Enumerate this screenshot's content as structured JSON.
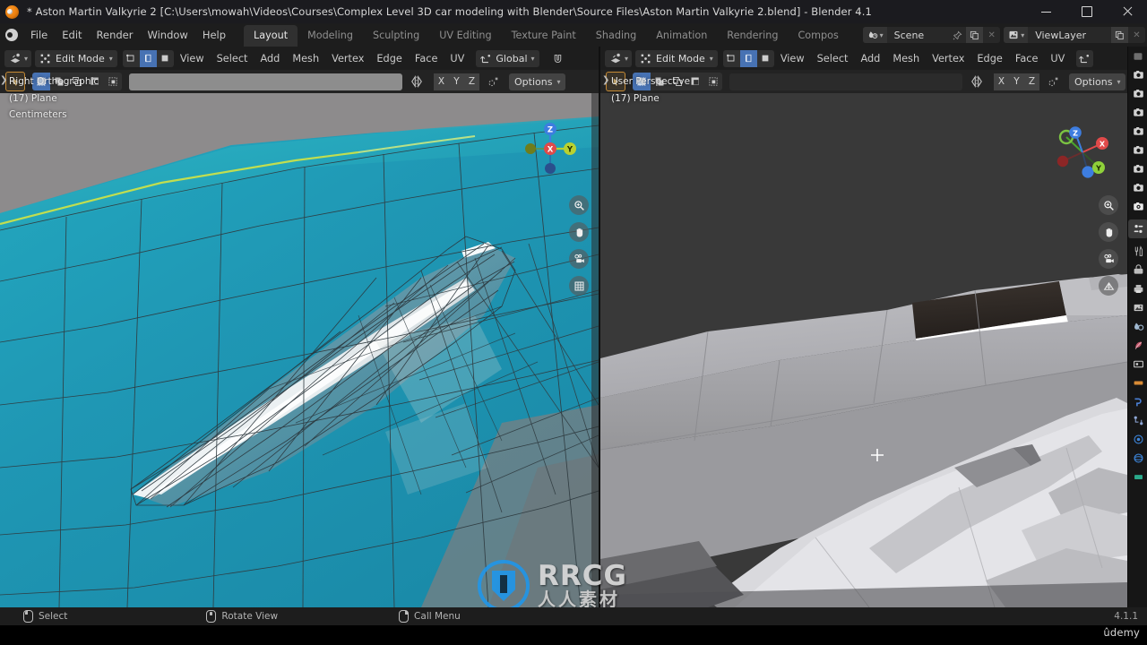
{
  "window": {
    "title": "* Aston Martin Valkyrie 2 [C:\\Users\\mowah\\Videos\\Courses\\Complex Level 3D car modeling with Blender\\Source Files\\Aston Martin Valkyrie 2.blend] - Blender 4.1",
    "app_icon": "blender-logo-icon",
    "controls": {
      "minimize": "minimize-icon",
      "maximize": "maximize-icon",
      "close": "close-icon"
    }
  },
  "topbar": {
    "app_menu_icon": "blender-menu-icon",
    "menus": [
      "File",
      "Edit",
      "Render",
      "Window",
      "Help"
    ],
    "workspace_tabs": [
      {
        "label": "Layout",
        "active": true
      },
      {
        "label": "Modeling",
        "active": false
      },
      {
        "label": "Sculpting",
        "active": false
      },
      {
        "label": "UV Editing",
        "active": false
      },
      {
        "label": "Texture Paint",
        "active": false
      },
      {
        "label": "Shading",
        "active": false
      },
      {
        "label": "Animation",
        "active": false
      },
      {
        "label": "Rendering",
        "active": false
      },
      {
        "label": "Compos",
        "active": false
      }
    ],
    "scene": {
      "icon": "scene-icon",
      "value": "Scene",
      "pin_icon": "pin-icon",
      "new_icon": "duplicate-icon",
      "unlink_icon": "x-icon"
    },
    "view_layer": {
      "icon": "view-layer-icon",
      "value": "ViewLayer",
      "new_icon": "duplicate-icon",
      "unlink_icon": "x-icon"
    }
  },
  "viewport_left": {
    "editor_type_icon": "editor-type-3dview-icon",
    "mode": "Edit Mode",
    "select_modes": [
      {
        "name": "vertex-select-icon",
        "active": false
      },
      {
        "name": "edge-select-icon",
        "active": true
      },
      {
        "name": "face-select-icon",
        "active": false
      }
    ],
    "menus": [
      "View",
      "Select",
      "Add",
      "Mesh",
      "Vertex",
      "Edge",
      "Face",
      "UV"
    ],
    "transform_orientation": {
      "icon": "orientation-icon",
      "value": "Global"
    },
    "tool_icon": "tweak-tool-icon",
    "snap_modes": [
      {
        "name": "set-mode-icon",
        "active": true
      },
      {
        "name": "extend-mode-icon",
        "active": false
      },
      {
        "name": "subtract-mode-icon",
        "active": false
      },
      {
        "name": "invert-mode-icon",
        "active": false
      },
      {
        "name": "intersect-mode-icon",
        "active": false
      }
    ],
    "mirror_icon": "mirror-icon",
    "axes": [
      "X",
      "Y",
      "Z"
    ],
    "proportional_icon": "proportional-editing-icon",
    "options_label": "Options",
    "overlay_lines": [
      "Right Orthographic",
      "(17) Plane",
      "Centimeters"
    ],
    "nav_gizmo": {
      "axis_labels": [
        "X",
        "Y",
        "Z"
      ],
      "colors": {
        "x": "#e04a4a",
        "y": "#b8d130",
        "z": "#3d7de0"
      }
    },
    "nav_buttons": [
      "zoom-icon",
      "pan-hand-icon",
      "camera-view-icon",
      "toggle-ortho-grid-icon"
    ]
  },
  "viewport_right": {
    "editor_type_icon": "editor-type-3dview-icon",
    "mode": "Edit Mode",
    "select_modes": [
      {
        "name": "vertex-select-icon",
        "active": false
      },
      {
        "name": "edge-select-icon",
        "active": true
      },
      {
        "name": "face-select-icon",
        "active": false
      }
    ],
    "menus": [
      "View",
      "Select",
      "Add",
      "Mesh",
      "Vertex",
      "Edge",
      "Face",
      "UV"
    ],
    "transform_orientation": {
      "icon": "orientation-icon",
      "value": ""
    },
    "tool_icon": "tweak-tool-icon",
    "snap_modes": [
      {
        "name": "set-mode-icon",
        "active": true
      },
      {
        "name": "extend-mode-icon",
        "active": false
      },
      {
        "name": "subtract-mode-icon",
        "active": false
      },
      {
        "name": "invert-mode-icon",
        "active": false
      },
      {
        "name": "intersect-mode-icon",
        "active": false
      }
    ],
    "mirror_icon": "mirror-icon",
    "axes": [
      "X",
      "Y",
      "Z"
    ],
    "proportional_icon": "proportional-editing-icon",
    "options_label": "Options",
    "overlay_lines": [
      "User Perspective",
      "(17) Plane"
    ],
    "nav_gizmo": {
      "axis_labels": [
        "X",
        "Y",
        "Z"
      ],
      "colors": {
        "x": "#e04a4a",
        "y": "#8fd13a",
        "z": "#3d7de0"
      }
    },
    "nav_buttons": [
      "zoom-icon",
      "pan-hand-icon",
      "camera-view-icon",
      "toggle-ortho-grid-icon"
    ]
  },
  "properties_strip": {
    "outliner_icons": [
      "render-props-icon",
      "output-props-icon",
      "view-layer-props-icon",
      "scene-props-icon",
      "world-props-icon",
      "collection-props-icon",
      "object-props-icon",
      "camera-data-icon"
    ],
    "editor_icons": [
      "properties-editor-icon",
      "tool-props-icon",
      "render-icon",
      "printer-icon",
      "images-icon",
      "world-icon",
      "object-icon",
      "modifier-icon",
      "particles-icon",
      "physics-icon",
      "constraints-icon",
      "data-icon",
      "material-icon",
      "texture-icon"
    ]
  },
  "statusbar": {
    "hints": [
      {
        "mouse": "left-mouse-icon",
        "label": "Select"
      },
      {
        "mouse": "middle-mouse-icon",
        "label": "Rotate View"
      },
      {
        "mouse": "right-mouse-icon",
        "label": "Call Menu"
      }
    ],
    "version": "4.1.1"
  },
  "watermarks": {
    "rrcg_en": "RRCG",
    "rrcg_cn": "人人素材",
    "udemy": "ûdemy"
  },
  "colors": {
    "accent_blue": "#4772b3",
    "viewport_bg": "#303030",
    "header_bg": "#1d1d1d",
    "car_teal": "#1c9cb5",
    "car_grey": "#b4b4b8",
    "rrcg_blue": "#2196e8"
  }
}
